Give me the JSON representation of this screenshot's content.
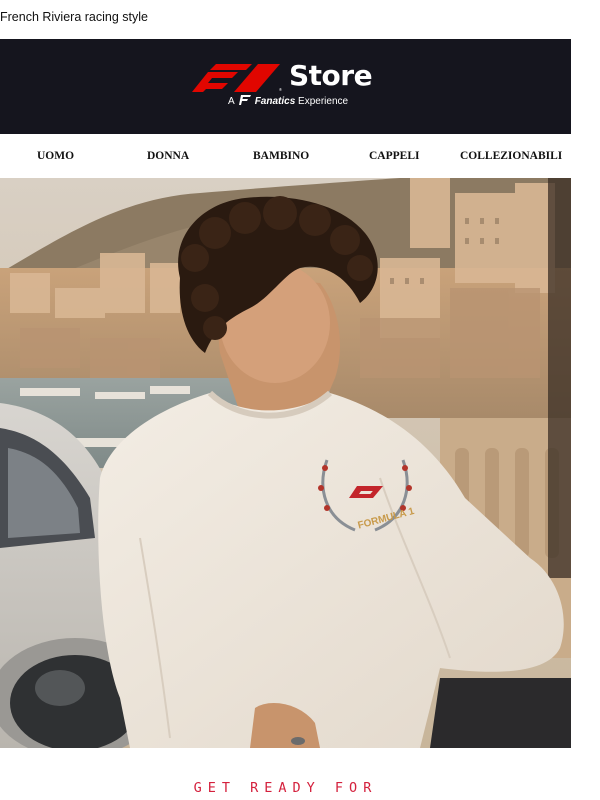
{
  "preheader": {
    "text": "French Riviera racing style"
  },
  "header": {
    "store_label": "Store",
    "tagline_prefix": "A",
    "tagline_brand": "Fanatics",
    "tagline_suffix": "Experience",
    "bg_color": "#15151e",
    "brand_color": "#e10600"
  },
  "nav": {
    "items": [
      {
        "label": "UOMO"
      },
      {
        "label": "DONNA"
      },
      {
        "label": "BAMBINO"
      },
      {
        "label": "CAPPELI"
      },
      {
        "label": "COLLEZIONABILI"
      }
    ]
  },
  "hero": {
    "alt": "hero-photo",
    "sweatshirt_print": "FORMULA 1"
  },
  "cta": {
    "headline": "GET READY FOR",
    "color": "#d4213d"
  }
}
